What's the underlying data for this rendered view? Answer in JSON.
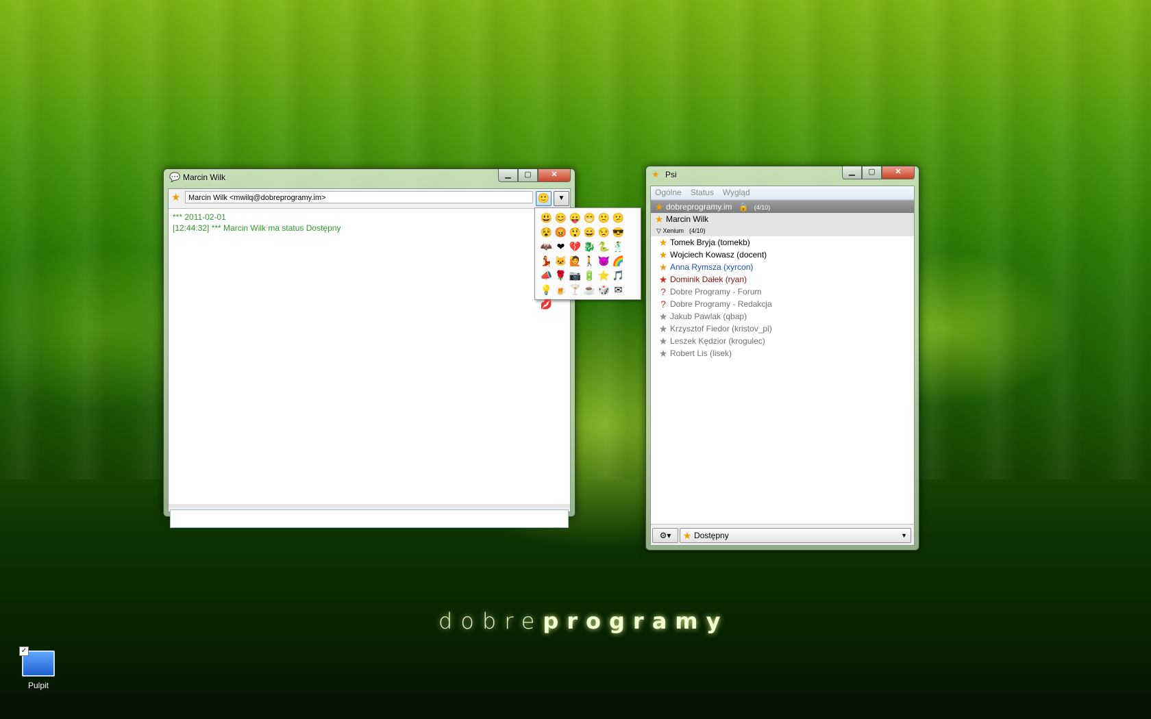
{
  "wallpaper": {
    "brand_light": "dobre",
    "brand_bold": "programy"
  },
  "desktop": {
    "icon_label": "Pulpit",
    "icon": "computer-icon"
  },
  "chat_window": {
    "title": "Marcin Wilk",
    "contact_field": "Marcin Wilk <mwilq@dobreprogramy.im>",
    "emoticon_button_icon": "smiley-icon",
    "menu_button_icon": "dropdown-arrow-icon",
    "log": [
      "*** 2011-02-01",
      "[12:44:32] *** Marcin Wilk ma status Dostępny"
    ],
    "log_color": "#2c9a28",
    "input_value": ""
  },
  "emoticon_popup": {
    "items": [
      "😃",
      "😊",
      "😛",
      "😁",
      "🙁",
      "😕",
      "😵",
      "😡",
      "😲",
      "😄",
      "😒",
      "😎",
      "🦇",
      "❤",
      "💔",
      "🐉",
      "🐍",
      "🕺",
      "💃",
      "🐱",
      "🙋",
      "🚶",
      "😈",
      "🌈",
      "📣",
      "🌹",
      "📷",
      "🔋",
      "⭐",
      "🎵",
      "💡",
      "🍺",
      "🍸",
      "☕",
      "🎲",
      "✉",
      "💋"
    ]
  },
  "psi_window": {
    "title": "Psi",
    "menu": [
      "Ogólne",
      "Status",
      "Wygląd"
    ],
    "account": {
      "name": "dobreprogramy.im",
      "lock_icon": "lock-icon",
      "count": "(4/10)"
    },
    "self": {
      "name": "Marcin Wilk",
      "status": "online"
    },
    "group": {
      "name": "Xenium",
      "count": "(4/10)"
    },
    "contacts": [
      {
        "name": "Tomek Bryja (tomekb)",
        "status": "online"
      },
      {
        "name": "Wojciech Kowasz (docent)",
        "status": "online"
      },
      {
        "name": "Anna Rymsza (xyrcon)",
        "status": "away"
      },
      {
        "name": "Dominik Dałek (ryan)",
        "status": "dnd"
      },
      {
        "name": "Dobre Programy - Forum",
        "status": "unknown"
      },
      {
        "name": "Dobre Programy - Redakcja",
        "status": "unknown"
      },
      {
        "name": "Jakub Pawlak (qbap)",
        "status": "offline"
      },
      {
        "name": "Krzysztof Fiedor (kristov_pl)",
        "status": "offline"
      },
      {
        "name": "Leszek Kędzior (krogulec)",
        "status": "offline"
      },
      {
        "name": "Robert Lis (lisek)",
        "status": "offline"
      }
    ],
    "status_selector": "Dostępny"
  },
  "colors": {
    "online": "#f0a000",
    "away": "#1c4fa8",
    "dnd": "#8a1212",
    "offline": "#707070"
  }
}
